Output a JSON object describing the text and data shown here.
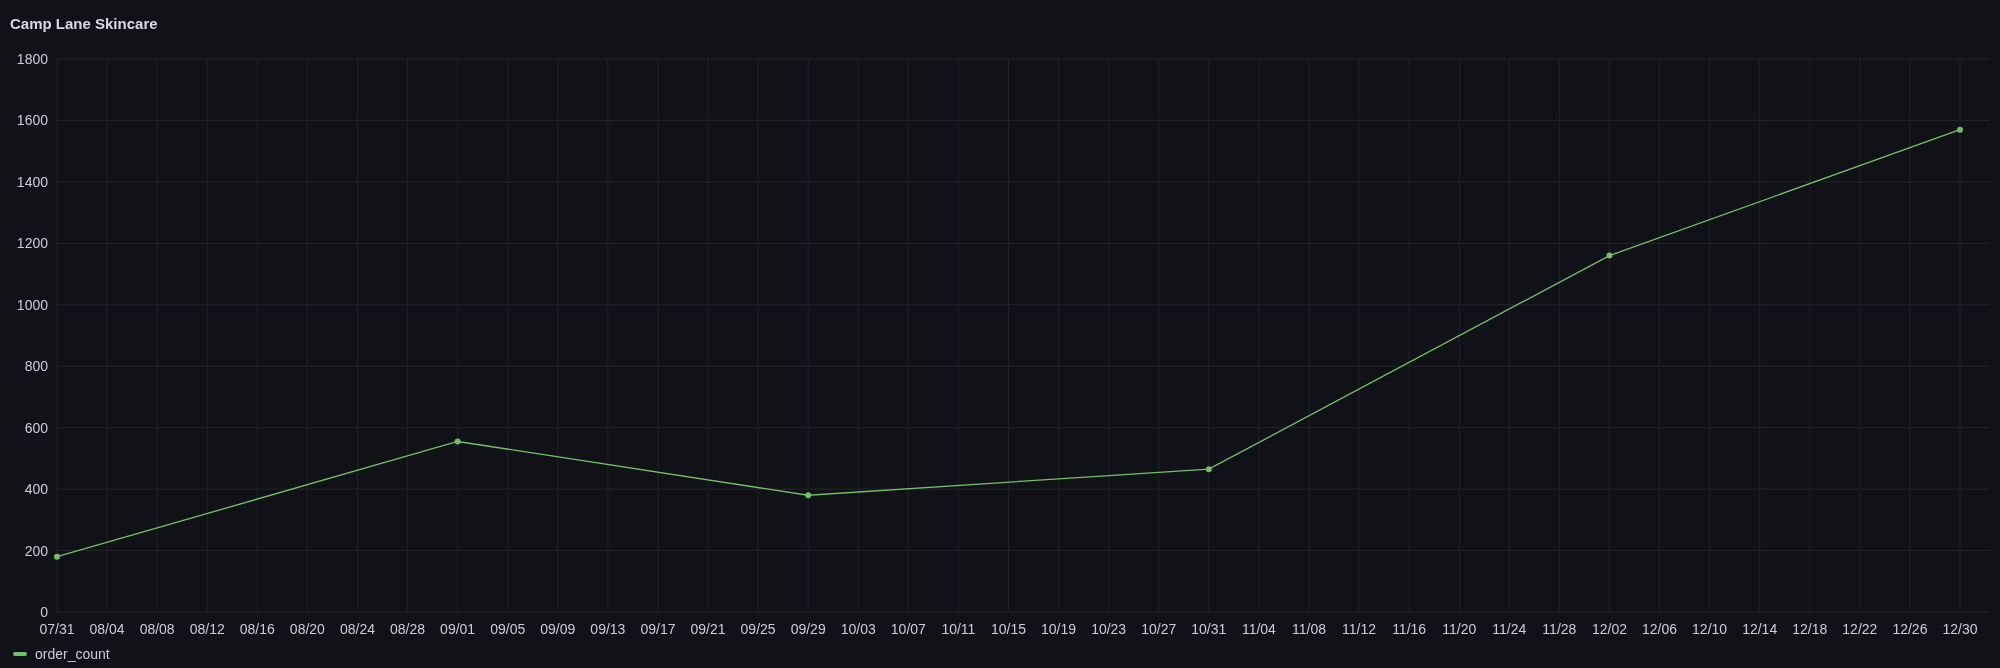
{
  "panel": {
    "title": "Camp Lane Skincare",
    "chart_data": {
      "type": "line",
      "grid": true,
      "ylim": [
        0,
        1800
      ],
      "yticks": [
        0,
        200,
        400,
        600,
        800,
        1000,
        1200,
        1400,
        1600,
        1800
      ],
      "categories": [
        "07/31",
        "08/04",
        "08/08",
        "08/12",
        "08/16",
        "08/20",
        "08/24",
        "08/28",
        "09/01",
        "09/05",
        "09/09",
        "09/13",
        "09/17",
        "09/21",
        "09/25",
        "09/29",
        "10/03",
        "10/07",
        "10/11",
        "10/15",
        "10/19",
        "10/23",
        "10/27",
        "10/31",
        "11/04",
        "11/08",
        "11/12",
        "11/16",
        "11/20",
        "11/24",
        "11/28",
        "12/02",
        "12/06",
        "12/10",
        "12/14",
        "12/18",
        "12/22",
        "12/26",
        "12/30"
      ],
      "series": [
        {
          "name": "order_count",
          "color": "#73bf69",
          "marker": true,
          "values": [
            180,
            null,
            null,
            null,
            null,
            null,
            null,
            null,
            555,
            null,
            null,
            null,
            null,
            null,
            null,
            380,
            null,
            null,
            null,
            null,
            null,
            null,
            null,
            465,
            null,
            null,
            null,
            null,
            null,
            null,
            null,
            1160,
            null,
            null,
            null,
            null,
            null,
            null,
            1570
          ]
        }
      ]
    }
  }
}
